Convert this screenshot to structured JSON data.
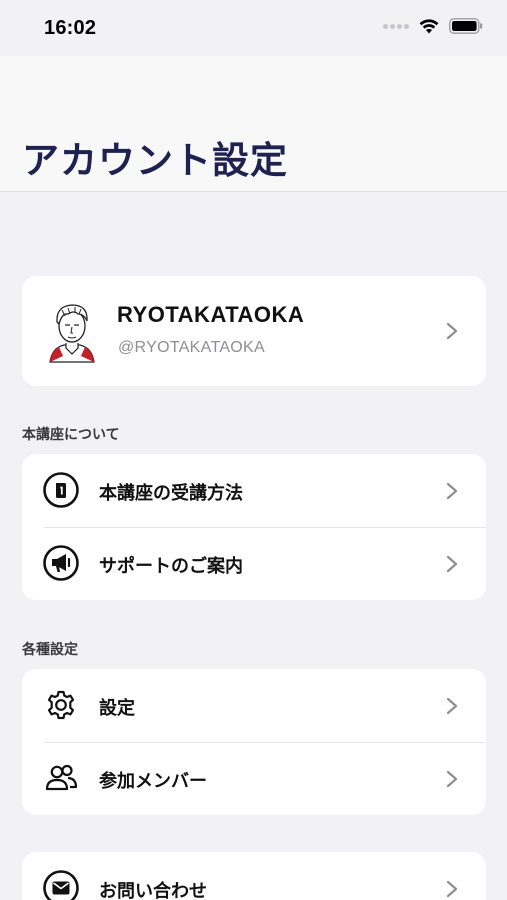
{
  "status_bar": {
    "time": "16:02"
  },
  "header": {
    "title": "アカウント設定"
  },
  "profile": {
    "name": "RYOTAKATAOKA",
    "handle": "@RYOTAKATAOKA"
  },
  "sections": {
    "course": {
      "label": "本講座について",
      "items": [
        {
          "label": "本講座の受講方法",
          "icon": "info-circle-icon"
        },
        {
          "label": "サポートのご案内",
          "icon": "megaphone-icon"
        }
      ]
    },
    "settings": {
      "label": "各種設定",
      "items": [
        {
          "label": "設定",
          "icon": "gear-icon"
        },
        {
          "label": "参加メンバー",
          "icon": "users-icon"
        }
      ]
    },
    "contact": {
      "items": [
        {
          "label": "お問い合わせ",
          "icon": "mail-icon"
        }
      ]
    }
  },
  "colors": {
    "title": "#1f2150",
    "background": "#f2f2f4",
    "card": "#ffffff",
    "chevron": "#8e8e93"
  }
}
